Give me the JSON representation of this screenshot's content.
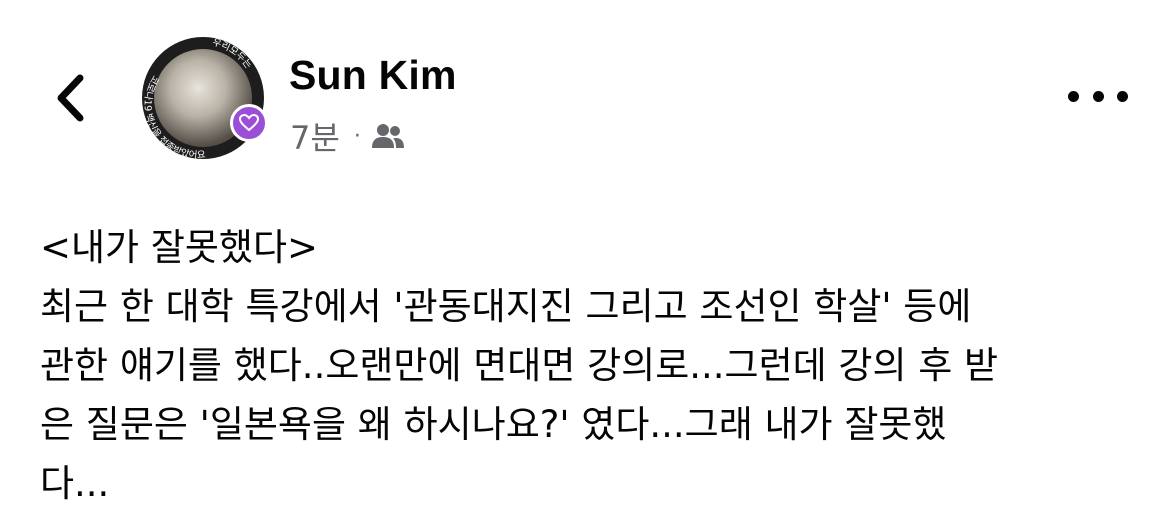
{
  "header": {
    "author_name": "Sun Kim",
    "timestamp": "7분",
    "separator": "·",
    "audience_icon": "friends-icon",
    "back_icon": "chevron-left-icon",
    "more_icon": "more-horizontal-icon"
  },
  "avatar": {
    "ring_text_right": "우리모두는",
    "ring_text_left": "코로나19 백신을 접종받았어요",
    "badge_icon": "heart-badge-icon",
    "badge_color": "#9b4fd6"
  },
  "post": {
    "lines": [
      "<내가 잘못했다>",
      "최근 한 대학 특강에서 '관동대지진 그리고 조선인 학살' 등에",
      "관한 얘기를 했다..오랜만에 면대면 강의로...그런데 강의 후 받",
      "은 질문은 '일본욕을 왜 하시나요?' 였다...그래 내가 잘못했",
      "다..."
    ]
  }
}
